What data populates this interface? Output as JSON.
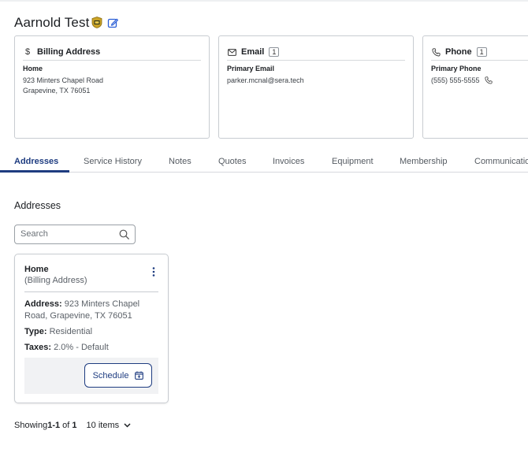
{
  "customer": {
    "name": "Aarnold Test"
  },
  "icons": {
    "badge": "shield-badge-icon",
    "edit": "edit-pencil-icon",
    "dollar": "dollar-icon",
    "email": "envelope-icon",
    "phone": "phone-icon",
    "search": "search-icon",
    "kebab": "kebab-menu-icon",
    "calendar": "calendar-add-icon",
    "chevron": "chevron-down-icon"
  },
  "colors": {
    "accent": "#1e3c80",
    "edit": "#2c5fd6",
    "badge": "#c9a227"
  },
  "cards": {
    "billing": {
      "icon_glyph": "$",
      "title": "Billing Address",
      "sub": "Home",
      "line1": "923 Minters Chapel Road",
      "line2": "Grapevine, TX 76051"
    },
    "email": {
      "title": "Email",
      "count": "1",
      "sub": "Primary Email",
      "line1": "parker.mcnal@sera.tech"
    },
    "phone": {
      "title": "Phone",
      "count": "1",
      "sub": "Primary Phone",
      "line1": "(555) 555-5555"
    }
  },
  "tabs": [
    "Addresses",
    "Service History",
    "Notes",
    "Quotes",
    "Invoices",
    "Equipment",
    "Membership",
    "Communications"
  ],
  "section": {
    "title": "Addresses"
  },
  "search": {
    "placeholder": "Search",
    "value": ""
  },
  "address_card": {
    "name": "Home",
    "sub": "(Billing Address)",
    "address_label": "Address:",
    "address_value": " 923 Minters Chapel Road, Grapevine, TX 76051",
    "type_label": "Type:",
    "type_value": " Residential",
    "taxes_label": "Taxes:",
    "taxes_value": " 2.0% - Default",
    "schedule_label": "Schedule"
  },
  "pager": {
    "prefix": "Showing ",
    "range": "1-1",
    "of": " of ",
    "total": "1",
    "per_page": "10 items"
  }
}
